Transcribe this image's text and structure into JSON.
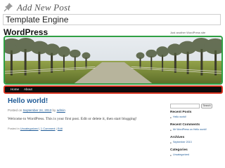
{
  "header": {
    "title": "Add New Post",
    "post_title_value": "Template Engine"
  },
  "site": {
    "title": "WordPress",
    "tagline": "Just another WordPress site"
  },
  "nav": {
    "items": [
      "Home",
      "About"
    ]
  },
  "post": {
    "title": "Hello world!",
    "meta_prefix": "Posted on ",
    "date": "September 24, 2013",
    "meta_by": " by ",
    "author": "admin",
    "body": "Welcome to WordPress. This is your first post. Edit or delete it, then start blogging!",
    "footer_prefix": "Posted in ",
    "category": "Uncategorized",
    "separator": " | ",
    "comments": "1 Comment",
    "edit": "Edit"
  },
  "sidebar": {
    "search_button": "Search",
    "recent_posts_title": "Recent Posts",
    "recent_posts": [
      "Hello world!"
    ],
    "recent_comments_title": "Recent Comments",
    "recent_comments": [
      "Mr WordPress on Hello world!"
    ],
    "archives_title": "Archives",
    "archives": [
      "September 2013"
    ],
    "categories_title": "Categories",
    "categories": [
      "Uncategorized"
    ]
  },
  "colors": {
    "header_highlight": "#2fa043",
    "nav_highlight": "#d9331f",
    "link": "#1e5a96"
  },
  "icons": {
    "header": "pushpin-icon"
  }
}
